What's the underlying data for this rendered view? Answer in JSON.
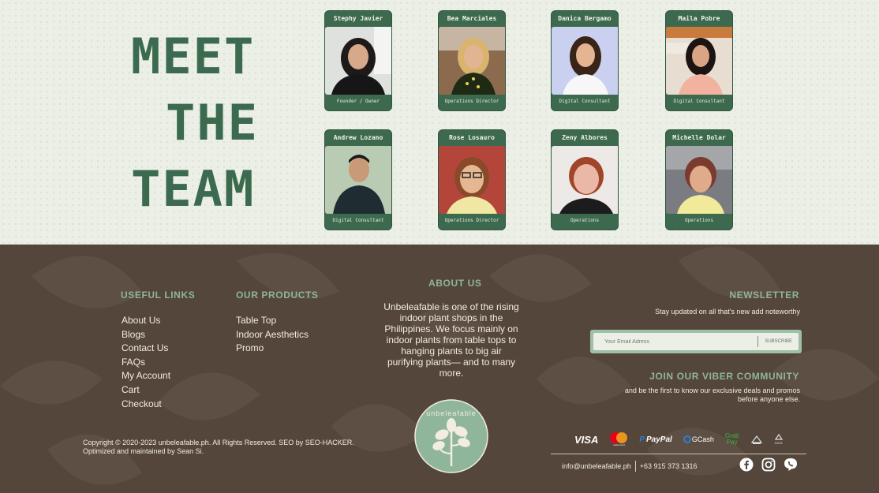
{
  "team": {
    "heading": [
      "MEET",
      "THE",
      "TEAM"
    ],
    "members": [
      {
        "name": "Stephy Javier",
        "role": "Founder / Owner"
      },
      {
        "name": "Bea Marciales",
        "role": "Operations Director"
      },
      {
        "name": "Danica Bergamo",
        "role": "Digital Consultant"
      },
      {
        "name": "Maila Pobre",
        "role": "Digital Consultant"
      },
      {
        "name": "Andrew Lozano",
        "role": "Digital Consultant"
      },
      {
        "name": "Rose Losauro",
        "role": "Operations Director"
      },
      {
        "name": "Zeny Albores",
        "role": "Operations"
      },
      {
        "name": "Michelle Dolar",
        "role": "Operations"
      }
    ]
  },
  "footer": {
    "useful_links": {
      "title": "USEFUL LINKS",
      "items": [
        "About Us",
        "Blogs",
        "Contact Us",
        "FAQs",
        "My Account",
        "Cart",
        "Checkout"
      ]
    },
    "our_products": {
      "title": "OUR PRODUCTS",
      "items": [
        "Table Top",
        "Indoor Aesthetics",
        "Promo"
      ]
    },
    "about": {
      "title": "ABOUT US",
      "text": "Unbeleafable is one of the rising indoor plant shops in the Philippines. We focus mainly on indoor plants from table tops to hanging plants to big air purifying plants— and to many more."
    },
    "logo": {
      "text": "unbeleafable",
      "sub": "ph"
    },
    "copyright": {
      "line1": "Copyright © 2020-2023 unbeleafable.ph. All Rights Reserved. SEO by SEO-HACKER.",
      "line2": "Optimized and maintained by Sean Si."
    },
    "newsletter": {
      "title": "NEWSLETTER",
      "subtitle": "Stay updated on all that's new add noteworthy",
      "placeholder": "Your Email Adress",
      "button": "SUBSCRIBE"
    },
    "viber": {
      "title": "JOIN OUR VIBER COMMUNITY",
      "line1": "and be the first to know our exclusive deals and promos",
      "line2": "before anyone else."
    },
    "payments": {
      "visa": "VISA",
      "mastercard": "mastercard",
      "paypal": "PayPal",
      "gcash": "GCash",
      "grabpay": [
        "Grab",
        "Pay"
      ],
      "other1": "",
      "other2": "DATA"
    },
    "contact": {
      "email": "info@unbeleafable.ph",
      "phone": "+63 915 373 1316"
    },
    "social_icons": [
      "facebook-icon",
      "instagram-icon",
      "viber-icon"
    ],
    "colors": {
      "accent_green": "#3d6a4f",
      "footer_brown": "#54463b",
      "light_green": "#8fb59a"
    }
  }
}
